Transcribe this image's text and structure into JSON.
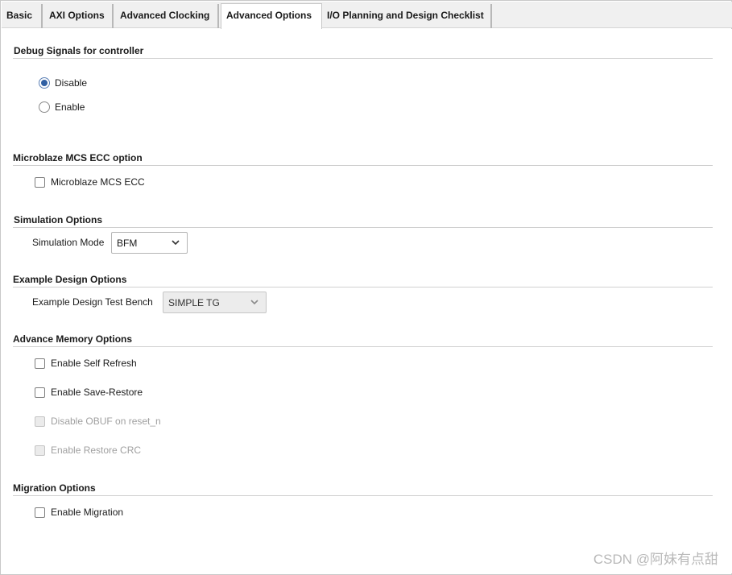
{
  "tabs": [
    {
      "label": "Basic",
      "active": false
    },
    {
      "label": "AXI Options",
      "active": false
    },
    {
      "label": "Advanced Clocking",
      "active": false
    },
    {
      "label": "Advanced Options",
      "active": true
    },
    {
      "label": "I/O Planning and Design Checklist",
      "active": false
    }
  ],
  "debug": {
    "title": "Debug Signals for controller",
    "options": [
      {
        "label": "Disable",
        "selected": true
      },
      {
        "label": "Enable",
        "selected": false
      }
    ]
  },
  "mcs": {
    "title": "Microblaze MCS ECC option",
    "checkbox_label": "Microblaze MCS ECC",
    "checked": false
  },
  "simulation": {
    "title": "Simulation Options",
    "field_label": "Simulation Mode",
    "value": "BFM"
  },
  "example": {
    "title": "Example Design Options",
    "field_label": "Example Design Test Bench",
    "value": "SIMPLE TG"
  },
  "memory": {
    "title": "Advance Memory Options",
    "items": [
      {
        "label": "Enable Self Refresh",
        "checked": false,
        "enabled": true
      },
      {
        "label": "Enable Save-Restore",
        "checked": false,
        "enabled": true
      },
      {
        "label": "Disable OBUF on reset_n",
        "checked": false,
        "enabled": false
      },
      {
        "label": "Enable Restore CRC",
        "checked": false,
        "enabled": false
      }
    ]
  },
  "migration": {
    "title": "Migration Options",
    "checkbox_label": "Enable Migration",
    "checked": false
  },
  "watermark": "CSDN @阿妹有点甜",
  "colors": {
    "radio_selected": "#2f5fa3",
    "disabled_text": "#a0a0a0"
  }
}
